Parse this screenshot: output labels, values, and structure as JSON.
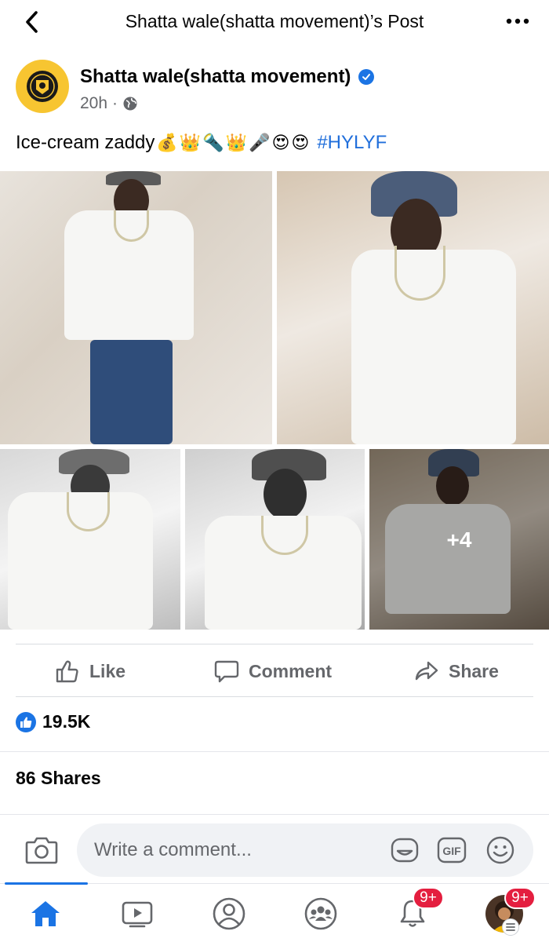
{
  "header": {
    "title": "Shatta wale(shatta movement)’s Post"
  },
  "post": {
    "author": "Shatta wale(shatta movement)",
    "time": "20h",
    "separator": "·",
    "caption_text": "Ice-cream zaddy",
    "caption_emojis": [
      "💰",
      "👑",
      "🔦",
      "👑",
      "🎤",
      "😍",
      "😍"
    ],
    "hashtag": "#HYLYF",
    "more_photos": "+4"
  },
  "actions": {
    "like": "Like",
    "comment": "Comment",
    "share": "Share"
  },
  "stats": {
    "reactions": "19.5K",
    "shares": "86 Shares"
  },
  "composer": {
    "placeholder": "Write a comment...",
    "gif_label": "GIF"
  },
  "tabs": {
    "notifications_badge": "9+",
    "menu_badge": "9+"
  },
  "colors": {
    "accent": "#1b74e4",
    "hashtag": "#216fdb",
    "badge": "#e41e3f",
    "muted": "#65676b"
  }
}
